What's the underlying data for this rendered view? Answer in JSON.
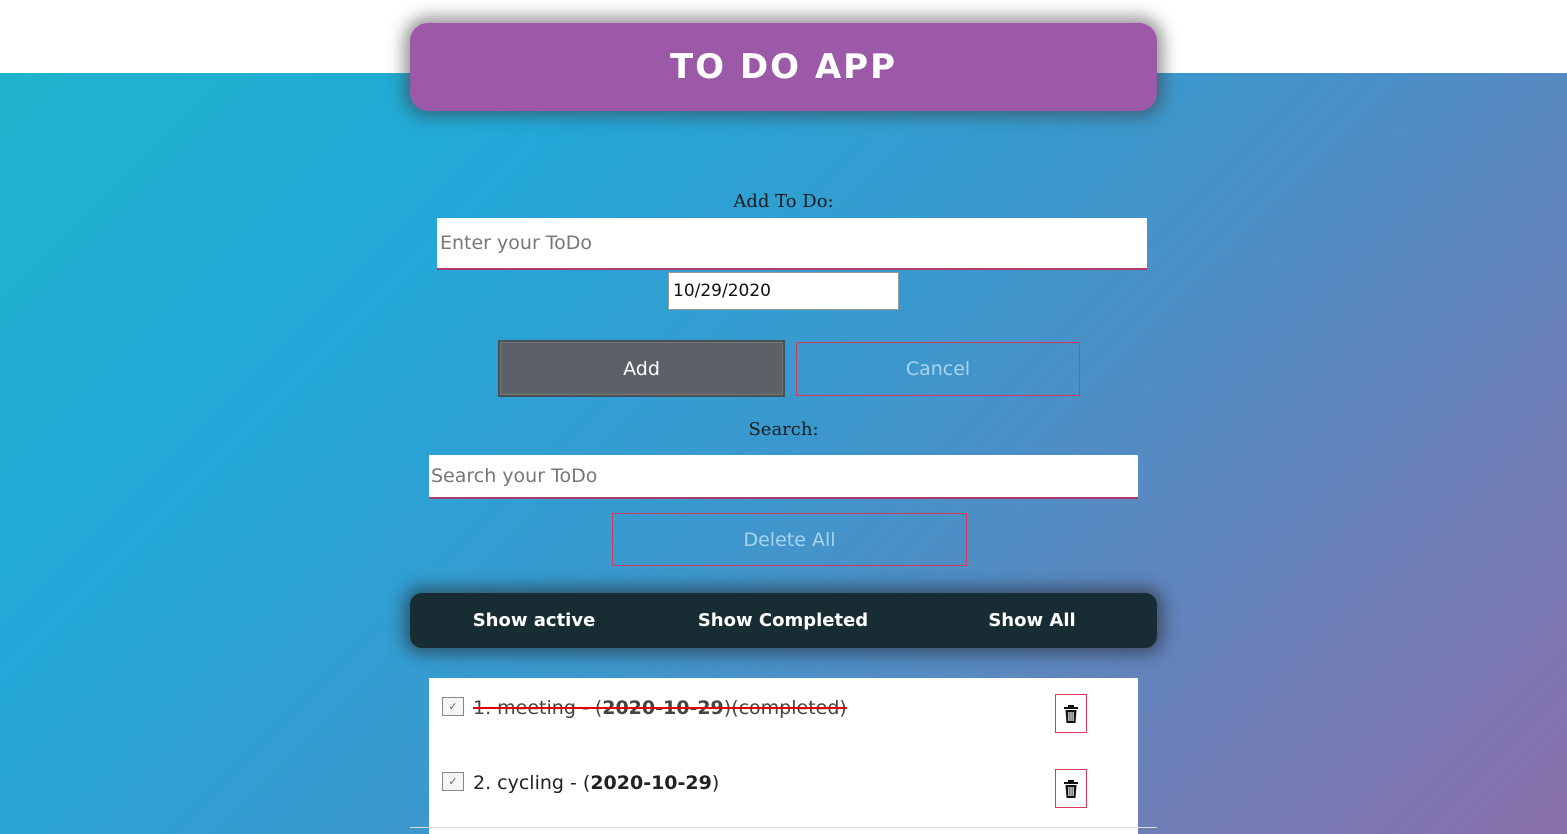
{
  "app": {
    "title": "TO DO APP"
  },
  "add_section": {
    "label": "Add To Do:",
    "todo_placeholder": "Enter your ToDo",
    "date_value": "10/29/2020",
    "add_label": "Add",
    "cancel_label": "Cancel"
  },
  "search_section": {
    "label": "Search:",
    "placeholder": "Search your ToDo",
    "delete_all_label": "Delete All"
  },
  "filters": {
    "active": "Show active",
    "completed": "Show Completed",
    "all": "Show All"
  },
  "todos": [
    {
      "prefix": "1. meeting - (",
      "date": "2020-10-29",
      "suffix": ")(completed)",
      "completed": true
    },
    {
      "prefix": "2. cycling - (",
      "date": "2020-10-29",
      "suffix": ")",
      "completed": false
    }
  ],
  "colors": {
    "header": "#9b59a8",
    "filter_bar": "#182c33",
    "add_button": "#5c6168",
    "outline_border": "#d9385a",
    "strike": "#e00000"
  },
  "icons": {
    "checkbox": "checkmark-icon",
    "delete": "trash-icon"
  }
}
